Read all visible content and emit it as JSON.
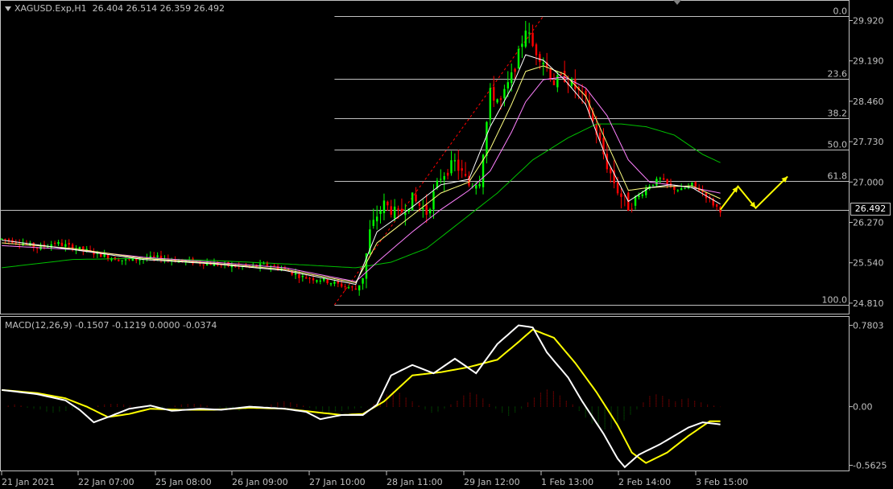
{
  "header": {
    "symbol": "XAGUSD.Exp,H1",
    "ohlc": "26.404 26.514 26.359 26.492"
  },
  "macd_header": "MACD(12,26,9) -0.1507 -0.1219 0.0000 -0.0374",
  "current_price": "26.492",
  "colors": {
    "bull": "#00ff00",
    "bear": "#ff0000",
    "ma_fast": "#ffffff",
    "ma_mid": "#ffff80",
    "ma_slow": "#ff80ff",
    "ma_long": "#00c000",
    "fib": "#c0c0c0",
    "trend": "#ff0000",
    "arrows": "#ffff00",
    "macd_line": "#ffffff",
    "signal_line": "#ffff00",
    "hist_pos": "#a00000",
    "hist_neg": "#006000"
  },
  "chart_data": [
    {
      "type": "candlestick",
      "title": "XAGUSD.Exp,H1",
      "ylim": [
        24.62,
        30.0
      ],
      "y_ticks": [
        "29.920",
        "29.190",
        "28.460",
        "27.730",
        "27.000",
        "26.270",
        "25.540",
        "24.810"
      ],
      "x_ticks": [
        "21 Jan 2021",
        "22 Jan 07:00",
        "25 Jan 08:00",
        "26 Jan 09:00",
        "27 Jan 10:00",
        "28 Jan 11:00",
        "29 Jan 12:00",
        "1 Feb 13:00",
        "2 Feb 14:00",
        "3 Feb 15:00"
      ],
      "fibonacci": {
        "levels": [
          {
            "label": "0.0",
            "price": 30.0
          },
          {
            "label": "23.6",
            "price": 28.86
          },
          {
            "label": "38.2",
            "price": 28.16
          },
          {
            "label": "50.0",
            "price": 27.59
          },
          {
            "label": "61.8",
            "price": 27.02
          },
          {
            "label": "100.0",
            "price": 24.78
          }
        ]
      },
      "price_path": [
        [
          0,
          25.97
        ],
        [
          5,
          25.92
        ],
        [
          10,
          25.81
        ],
        [
          15,
          25.9
        ],
        [
          20,
          25.82
        ],
        [
          25,
          25.74
        ],
        [
          30,
          25.65
        ],
        [
          35,
          25.58
        ],
        [
          40,
          25.62
        ],
        [
          45,
          25.63
        ],
        [
          50,
          25.58
        ],
        [
          55,
          25.55
        ],
        [
          60,
          25.52
        ],
        [
          65,
          25.48
        ],
        [
          70,
          25.47
        ],
        [
          75,
          25.5
        ],
        [
          80,
          25.42
        ],
        [
          85,
          25.28
        ],
        [
          90,
          25.24
        ],
        [
          95,
          25.15
        ],
        [
          100,
          25.06
        ],
        [
          102,
          25.3
        ],
        [
          104,
          26.1
        ],
        [
          106,
          26.4
        ],
        [
          108,
          26.6
        ],
        [
          112,
          26.4
        ],
        [
          116,
          26.7
        ],
        [
          120,
          26.45
        ],
        [
          124,
          27.1
        ],
        [
          128,
          27.35
        ],
        [
          132,
          26.95
        ],
        [
          135,
          27.05
        ],
        [
          138,
          28.6
        ],
        [
          141,
          28.45
        ],
        [
          144,
          28.9
        ],
        [
          146,
          29.3
        ],
        [
          148,
          29.8
        ],
        [
          150,
          29.45
        ],
        [
          153,
          29.2
        ],
        [
          156,
          28.8
        ],
        [
          159,
          28.9
        ],
        [
          162,
          28.7
        ],
        [
          165,
          28.45
        ],
        [
          168,
          27.9
        ],
        [
          171,
          27.3
        ],
        [
          174,
          26.85
        ],
        [
          177,
          26.55
        ],
        [
          180,
          26.75
        ],
        [
          183,
          26.95
        ],
        [
          186,
          27.05
        ],
        [
          189,
          26.9
        ],
        [
          192,
          26.85
        ],
        [
          195,
          26.95
        ],
        [
          198,
          26.82
        ],
        [
          201,
          26.6
        ],
        [
          203,
          26.492
        ]
      ],
      "ma_fast_path": [
        [
          0,
          25.95
        ],
        [
          20,
          25.78
        ],
        [
          40,
          25.6
        ],
        [
          60,
          25.52
        ],
        [
          80,
          25.4
        ],
        [
          100,
          25.15
        ],
        [
          106,
          26.1
        ],
        [
          116,
          26.55
        ],
        [
          124,
          26.95
        ],
        [
          132,
          27.05
        ],
        [
          138,
          28.0
        ],
        [
          144,
          28.7
        ],
        [
          148,
          29.3
        ],
        [
          153,
          29.2
        ],
        [
          159,
          28.85
        ],
        [
          165,
          28.4
        ],
        [
          171,
          27.4
        ],
        [
          177,
          26.65
        ],
        [
          183,
          26.9
        ],
        [
          189,
          26.95
        ],
        [
          195,
          26.9
        ],
        [
          203,
          26.6
        ]
      ],
      "ma_mid_path": [
        [
          0,
          25.9
        ],
        [
          20,
          25.8
        ],
        [
          40,
          25.62
        ],
        [
          60,
          25.53
        ],
        [
          80,
          25.42
        ],
        [
          100,
          25.18
        ],
        [
          106,
          25.9
        ],
        [
          116,
          26.4
        ],
        [
          124,
          26.8
        ],
        [
          132,
          27.0
        ],
        [
          138,
          27.6
        ],
        [
          144,
          28.4
        ],
        [
          148,
          29.0
        ],
        [
          153,
          29.1
        ],
        [
          159,
          28.95
        ],
        [
          165,
          28.55
        ],
        [
          171,
          27.7
        ],
        [
          177,
          26.85
        ],
        [
          183,
          26.9
        ],
        [
          189,
          26.92
        ],
        [
          195,
          26.93
        ],
        [
          203,
          26.7
        ]
      ],
      "ma_slow_path": [
        [
          0,
          25.85
        ],
        [
          20,
          25.78
        ],
        [
          40,
          25.64
        ],
        [
          60,
          25.55
        ],
        [
          80,
          25.45
        ],
        [
          100,
          25.2
        ],
        [
          106,
          25.55
        ],
        [
          116,
          26.1
        ],
        [
          124,
          26.5
        ],
        [
          132,
          26.85
        ],
        [
          138,
          27.2
        ],
        [
          144,
          27.9
        ],
        [
          148,
          28.45
        ],
        [
          153,
          28.85
        ],
        [
          159,
          28.9
        ],
        [
          165,
          28.7
        ],
        [
          171,
          28.2
        ],
        [
          177,
          27.4
        ],
        [
          183,
          27.0
        ],
        [
          189,
          26.95
        ],
        [
          195,
          26.9
        ],
        [
          203,
          26.8
        ]
      ],
      "ma_long_path": [
        [
          0,
          25.45
        ],
        [
          20,
          25.6
        ],
        [
          40,
          25.62
        ],
        [
          60,
          25.58
        ],
        [
          80,
          25.52
        ],
        [
          100,
          25.45
        ],
        [
          110,
          25.55
        ],
        [
          120,
          25.8
        ],
        [
          130,
          26.3
        ],
        [
          140,
          26.8
        ],
        [
          150,
          27.4
        ],
        [
          160,
          27.8
        ],
        [
          168,
          28.05
        ],
        [
          175,
          28.05
        ],
        [
          182,
          28.0
        ],
        [
          190,
          27.85
        ],
        [
          198,
          27.5
        ],
        [
          203,
          27.35
        ]
      ],
      "projection": [
        [
          203,
          26.5
        ],
        [
          208,
          26.92
        ],
        [
          213,
          26.53
        ],
        [
          222,
          27.1
        ]
      ]
    },
    {
      "type": "macd",
      "title": "MACD(12,26,9) -0.1507 -0.1219 0.0000 -0.0374",
      "ylim": [
        -0.62,
        0.83
      ],
      "y_ticks": [
        "0.7803",
        "0.00",
        "-0.5625"
      ],
      "macd_path": [
        [
          0,
          0.16
        ],
        [
          10,
          0.12
        ],
        [
          18,
          0.06
        ],
        [
          22,
          -0.03
        ],
        [
          26,
          -0.15
        ],
        [
          30,
          -0.1
        ],
        [
          36,
          -0.02
        ],
        [
          42,
          0.01
        ],
        [
          48,
          -0.04
        ],
        [
          56,
          -0.02
        ],
        [
          62,
          -0.03
        ],
        [
          70,
          0.0
        ],
        [
          80,
          -0.02
        ],
        [
          86,
          -0.05
        ],
        [
          90,
          -0.12
        ],
        [
          96,
          -0.08
        ],
        [
          102,
          -0.08
        ],
        [
          106,
          0.02
        ],
        [
          110,
          0.3
        ],
        [
          116,
          0.4
        ],
        [
          122,
          0.32
        ],
        [
          128,
          0.46
        ],
        [
          134,
          0.32
        ],
        [
          140,
          0.6
        ],
        [
          146,
          0.78
        ],
        [
          150,
          0.76
        ],
        [
          154,
          0.52
        ],
        [
          160,
          0.28
        ],
        [
          164,
          0.05
        ],
        [
          170,
          -0.26
        ],
        [
          174,
          -0.5
        ],
        [
          176,
          -0.58
        ],
        [
          180,
          -0.46
        ],
        [
          186,
          -0.36
        ],
        [
          190,
          -0.28
        ],
        [
          194,
          -0.2
        ],
        [
          198,
          -0.15
        ],
        [
          203,
          -0.17
        ]
      ],
      "signal_path": [
        [
          0,
          0.16
        ],
        [
          10,
          0.13
        ],
        [
          18,
          0.08
        ],
        [
          24,
          0.0
        ],
        [
          30,
          -0.1
        ],
        [
          36,
          -0.07
        ],
        [
          42,
          -0.02
        ],
        [
          50,
          -0.03
        ],
        [
          60,
          -0.03
        ],
        [
          70,
          -0.01
        ],
        [
          80,
          -0.02
        ],
        [
          88,
          -0.05
        ],
        [
          96,
          -0.08
        ],
        [
          102,
          -0.07
        ],
        [
          108,
          0.05
        ],
        [
          116,
          0.3
        ],
        [
          124,
          0.33
        ],
        [
          132,
          0.38
        ],
        [
          140,
          0.45
        ],
        [
          146,
          0.62
        ],
        [
          150,
          0.74
        ],
        [
          156,
          0.66
        ],
        [
          162,
          0.42
        ],
        [
          168,
          0.14
        ],
        [
          174,
          -0.18
        ],
        [
          178,
          -0.44
        ],
        [
          182,
          -0.54
        ],
        [
          188,
          -0.44
        ],
        [
          194,
          -0.28
        ],
        [
          200,
          -0.14
        ],
        [
          203,
          -0.14
        ]
      ],
      "histogram": [
        0.0,
        0.01,
        0.02,
        0.01,
        -0.01,
        -0.02,
        -0.03,
        -0.05,
        -0.06,
        -0.05,
        -0.04,
        -0.03,
        -0.02,
        -0.01,
        0.0,
        0.01,
        0.02,
        0.03,
        0.03,
        0.02,
        0.01,
        0.0,
        -0.01,
        -0.02,
        -0.02,
        -0.01,
        0.0,
        0.01,
        0.02,
        0.03,
        0.03,
        0.02,
        0.01,
        0.0,
        -0.01,
        -0.02,
        -0.03,
        -0.04,
        -0.03,
        -0.02,
        -0.01,
        0.0,
        0.02,
        0.04,
        0.05,
        0.04,
        0.03,
        0.01,
        -0.01,
        -0.03,
        -0.05,
        -0.06,
        -0.05,
        -0.04,
        -0.03,
        -0.02,
        -0.01,
        0.0,
        0.03,
        0.07,
        0.12,
        0.15,
        0.13,
        0.09,
        0.05,
        0.01,
        -0.03,
        -0.06,
        -0.05,
        -0.02,
        0.02,
        0.06,
        0.11,
        0.14,
        0.12,
        0.08,
        0.03,
        -0.02,
        -0.06,
        -0.09,
        -0.06,
        -0.02,
        0.04,
        0.09,
        0.14,
        0.17,
        0.15,
        0.11,
        0.06,
        0.02,
        -0.04,
        -0.1,
        -0.16,
        -0.2,
        -0.22,
        -0.21,
        -0.18,
        -0.13,
        -0.08,
        -0.03,
        0.04,
        0.1,
        0.12,
        0.1,
        0.07,
        0.05,
        0.07,
        0.08,
        0.06,
        0.04,
        0.02,
        0.01,
        0.0
      ]
    }
  ]
}
